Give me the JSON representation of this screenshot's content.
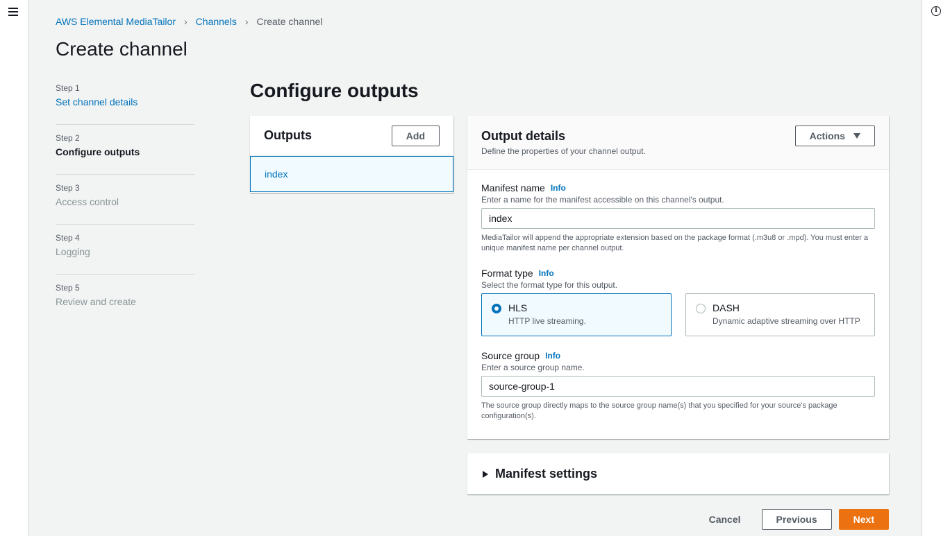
{
  "breadcrumb": {
    "items": [
      "AWS Elemental MediaTailor",
      "Channels"
    ],
    "current": "Create channel"
  },
  "page": {
    "title": "Create channel"
  },
  "steps": [
    {
      "num": "Step 1",
      "label": "Set channel details",
      "state": "link"
    },
    {
      "num": "Step 2",
      "label": "Configure outputs",
      "state": "active"
    },
    {
      "num": "Step 3",
      "label": "Access control",
      "state": "disabled"
    },
    {
      "num": "Step 4",
      "label": "Logging",
      "state": "disabled"
    },
    {
      "num": "Step 5",
      "label": "Review and create",
      "state": "disabled"
    }
  ],
  "section": {
    "title": "Configure outputs"
  },
  "outputs": {
    "title": "Outputs",
    "add_label": "Add",
    "items": [
      "index"
    ]
  },
  "details": {
    "title": "Output details",
    "description": "Define the properties of your channel output.",
    "actions_label": "Actions",
    "info_label": "Info",
    "manifest_name": {
      "label": "Manifest name",
      "description": "Enter a name for the manifest accessible on this channel's output.",
      "value": "index",
      "constraint": "MediaTailor will append the appropriate extension based on the package format (.m3u8 or .mpd). You must enter a unique manifest name per channel output."
    },
    "format_type": {
      "label": "Format type",
      "description": "Select the format type for this output.",
      "options": [
        {
          "title": "HLS",
          "desc": "HTTP live streaming."
        },
        {
          "title": "DASH",
          "desc": "Dynamic adaptive streaming over HTTP"
        }
      ],
      "selected": "HLS"
    },
    "source_group": {
      "label": "Source group",
      "description": "Enter a source group name.",
      "value": "source-group-1",
      "constraint": "The source group directly maps to the source group name(s) that you specified for your source's package configuration(s)."
    }
  },
  "manifest_settings": {
    "title": "Manifest settings"
  },
  "footer": {
    "cancel_label": "Cancel",
    "previous_label": "Previous",
    "next_label": "Next"
  },
  "colors": {
    "link": "#0073bb",
    "primary": "#ec7211",
    "background": "#f2f3f3"
  }
}
